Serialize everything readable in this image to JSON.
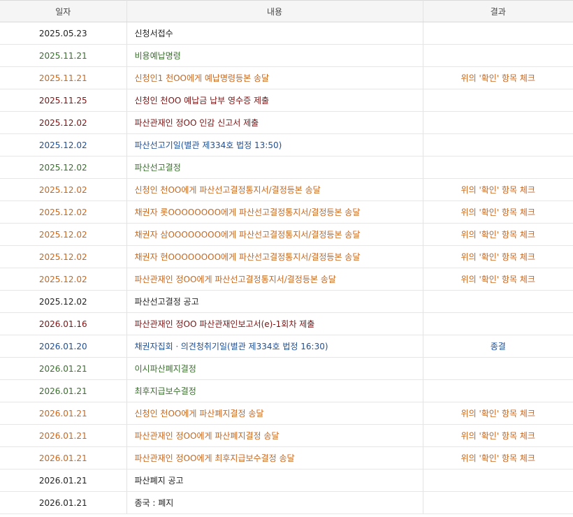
{
  "header": {
    "date": "일자",
    "content": "내용",
    "result": "결과"
  },
  "colors": {
    "black": "#222222",
    "green": "#3a6e2e",
    "orange": "#c8671f",
    "maroon": "#7a1414",
    "blue": "#1f4f95"
  },
  "rows": [
    {
      "date": "2025.05.23",
      "content": "신청서접수",
      "result": "",
      "color": "black"
    },
    {
      "date": "2025.11.21",
      "content": "비용예납명령",
      "result": "",
      "color": "green"
    },
    {
      "date": "2025.11.21",
      "content": "신청인1 천OO에게 예납명령등본 송달",
      "result": "위의 '확인' 항목 체크",
      "color": "orange"
    },
    {
      "date": "2025.11.25",
      "content": "신청인 천OO 예납금 납부 영수증 제출",
      "result": "",
      "color": "maroon"
    },
    {
      "date": "2025.12.02",
      "content": "파산관재인 정OO 인감 신고서 제출",
      "result": "",
      "color": "maroon"
    },
    {
      "date": "2025.12.02",
      "content": "파산선고기일(별관 제334호 법정 13:50)",
      "result": "",
      "color": "blue"
    },
    {
      "date": "2025.12.02",
      "content": "파산선고결정",
      "result": "",
      "color": "green"
    },
    {
      "date": "2025.12.02",
      "content": "신청인 천OO에게 파산선고결정통지서/결정등본 송달",
      "result": "위의 '확인' 항목 체크",
      "color": "orange"
    },
    {
      "date": "2025.12.02",
      "content": "채권자 롯OOOOOOOO에게 파산선고결정통지서/결정등본 송달",
      "result": "위의 '확인' 항목 체크",
      "color": "orange"
    },
    {
      "date": "2025.12.02",
      "content": "채권자 삼OOOOOOOO에게 파산선고결정통지서/결정등본 송달",
      "result": "위의 '확인' 항목 체크",
      "color": "orange"
    },
    {
      "date": "2025.12.02",
      "content": "채권자 현OOOOOOOO에게 파산선고결정통지서/결정등본 송달",
      "result": "위의 '확인' 항목 체크",
      "color": "orange"
    },
    {
      "date": "2025.12.02",
      "content": "파산관재인 정OO에게 파산선고결정통지서/결정등본 송달",
      "result": "위의 '확인' 항목 체크",
      "color": "orange"
    },
    {
      "date": "2025.12.02",
      "content": "파산선고결정 공고",
      "result": "",
      "color": "black"
    },
    {
      "date": "2026.01.16",
      "content": "파산관재인 정OO 파산관재인보고서(e)-1회차 제출",
      "result": "",
      "color": "maroon"
    },
    {
      "date": "2026.01.20",
      "content": "채권자집회ㆍ의견청취기일(별관 제334호 법정 16:30)",
      "result": "종결",
      "color": "blue"
    },
    {
      "date": "2026.01.21",
      "content": "이시파산폐지결정",
      "result": "",
      "color": "green"
    },
    {
      "date": "2026.01.21",
      "content": "최후지급보수결정",
      "result": "",
      "color": "green"
    },
    {
      "date": "2026.01.21",
      "content": "신청인 천OO에게 파산폐지결정 송달",
      "result": "위의 '확인' 항목 체크",
      "color": "orange"
    },
    {
      "date": "2026.01.21",
      "content": "파산관재인 정OO에게 파산폐지결정 송달",
      "result": "위의 '확인' 항목 체크",
      "color": "orange"
    },
    {
      "date": "2026.01.21",
      "content": "파산관재인 정OO에게 최후지급보수결정 송달",
      "result": "위의 '확인' 항목 체크",
      "color": "orange"
    },
    {
      "date": "2026.01.21",
      "content": "파산폐지 공고",
      "result": "",
      "color": "black"
    },
    {
      "date": "2026.01.21",
      "content": "종국 : 폐지",
      "result": "",
      "color": "black"
    }
  ]
}
